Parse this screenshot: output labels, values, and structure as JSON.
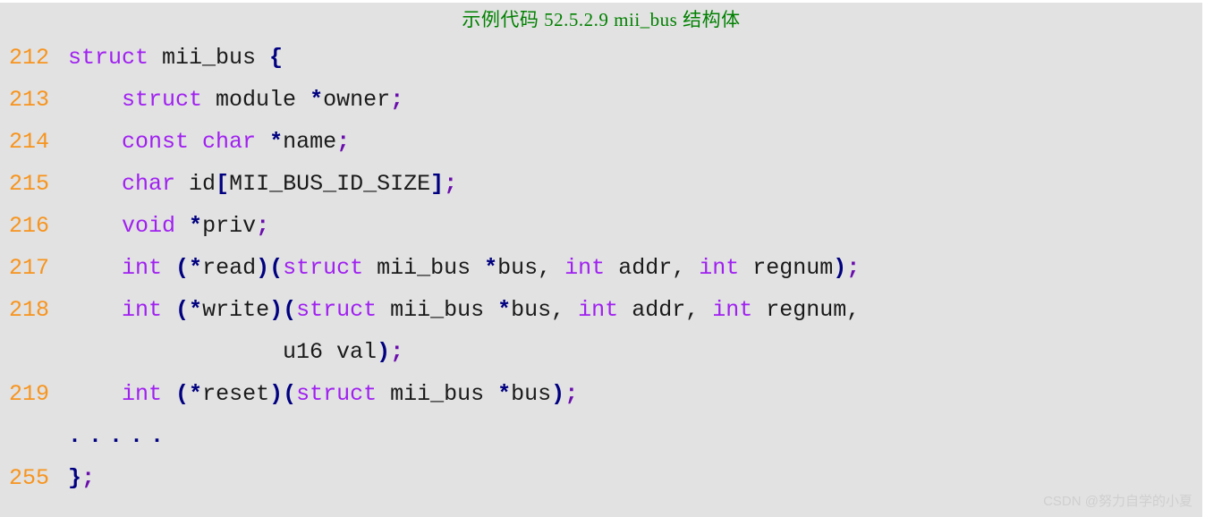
{
  "panel": {
    "background_color": "#e2e2e2",
    "title": "示例代码 52.5.2.9 mii_bus 结构体",
    "title_color": "#008000"
  },
  "colors": {
    "line_number": "#f7941e",
    "keyword": "#a020f0",
    "identifier": "#1a1a1a",
    "punctuation": "#000080",
    "semicolon": "#6a0dad",
    "watermark": "#cfcfcf"
  },
  "code": {
    "language": "c",
    "lines": [
      {
        "number": "212",
        "text": "struct mii_bus {",
        "tokens": [
          {
            "t": "kw",
            "v": "struct"
          },
          {
            "t": "id",
            "v": " mii_bus "
          },
          {
            "t": "punc",
            "v": "{"
          }
        ]
      },
      {
        "number": "213",
        "text": "    struct module *owner;",
        "tokens": [
          {
            "t": "id",
            "v": "    "
          },
          {
            "t": "kw",
            "v": "struct"
          },
          {
            "t": "id",
            "v": " module "
          },
          {
            "t": "punc",
            "v": "*"
          },
          {
            "t": "id",
            "v": "owner"
          },
          {
            "t": "semi",
            "v": ";"
          }
        ]
      },
      {
        "number": "214",
        "text": "    const char *name;",
        "tokens": [
          {
            "t": "id",
            "v": "    "
          },
          {
            "t": "kw",
            "v": "const char"
          },
          {
            "t": "id",
            "v": " "
          },
          {
            "t": "punc",
            "v": "*"
          },
          {
            "t": "id",
            "v": "name"
          },
          {
            "t": "semi",
            "v": ";"
          }
        ]
      },
      {
        "number": "215",
        "text": "    char id[MII_BUS_ID_SIZE];",
        "tokens": [
          {
            "t": "id",
            "v": "    "
          },
          {
            "t": "kw",
            "v": "char"
          },
          {
            "t": "id",
            "v": " id"
          },
          {
            "t": "punc",
            "v": "["
          },
          {
            "t": "id",
            "v": "MII_BUS_ID_SIZE"
          },
          {
            "t": "punc",
            "v": "]"
          },
          {
            "t": "semi",
            "v": ";"
          }
        ]
      },
      {
        "number": "216",
        "text": "    void *priv;",
        "tokens": [
          {
            "t": "id",
            "v": "    "
          },
          {
            "t": "kw",
            "v": "void"
          },
          {
            "t": "id",
            "v": " "
          },
          {
            "t": "punc",
            "v": "*"
          },
          {
            "t": "id",
            "v": "priv"
          },
          {
            "t": "semi",
            "v": ";"
          }
        ]
      },
      {
        "number": "217",
        "text": "    int (*read)(struct mii_bus *bus, int addr, int regnum);",
        "tokens": [
          {
            "t": "id",
            "v": "    "
          },
          {
            "t": "kw",
            "v": "int"
          },
          {
            "t": "id",
            "v": " "
          },
          {
            "t": "punc",
            "v": "(*"
          },
          {
            "t": "id",
            "v": "read"
          },
          {
            "t": "punc",
            "v": ")("
          },
          {
            "t": "kw",
            "v": "struct"
          },
          {
            "t": "id",
            "v": " mii_bus "
          },
          {
            "t": "punc",
            "v": "*"
          },
          {
            "t": "id",
            "v": "bus, "
          },
          {
            "t": "kw",
            "v": "int"
          },
          {
            "t": "id",
            "v": " addr, "
          },
          {
            "t": "kw",
            "v": "int"
          },
          {
            "t": "id",
            "v": " regnum"
          },
          {
            "t": "punc",
            "v": ")"
          },
          {
            "t": "semi",
            "v": ";"
          }
        ]
      },
      {
        "number": "218",
        "text": "    int (*write)(struct mii_bus *bus, int addr, int regnum,",
        "tokens": [
          {
            "t": "id",
            "v": "    "
          },
          {
            "t": "kw",
            "v": "int"
          },
          {
            "t": "id",
            "v": " "
          },
          {
            "t": "punc",
            "v": "(*"
          },
          {
            "t": "id",
            "v": "write"
          },
          {
            "t": "punc",
            "v": ")("
          },
          {
            "t": "kw",
            "v": "struct"
          },
          {
            "t": "id",
            "v": " mii_bus "
          },
          {
            "t": "punc",
            "v": "*"
          },
          {
            "t": "id",
            "v": "bus, "
          },
          {
            "t": "kw",
            "v": "int"
          },
          {
            "t": "id",
            "v": " addr, "
          },
          {
            "t": "kw",
            "v": "int"
          },
          {
            "t": "id",
            "v": " regnum,"
          }
        ]
      },
      {
        "number": "",
        "text": "                u16 val);",
        "tokens": [
          {
            "t": "id",
            "v": "                u16 val"
          },
          {
            "t": "punc",
            "v": ")"
          },
          {
            "t": "semi",
            "v": ";"
          }
        ]
      },
      {
        "number": "219",
        "text": "    int (*reset)(struct mii_bus *bus);",
        "tokens": [
          {
            "t": "id",
            "v": "    "
          },
          {
            "t": "kw",
            "v": "int"
          },
          {
            "t": "id",
            "v": " "
          },
          {
            "t": "punc",
            "v": "(*"
          },
          {
            "t": "id",
            "v": "reset"
          },
          {
            "t": "punc",
            "v": ")("
          },
          {
            "t": "kw",
            "v": "struct"
          },
          {
            "t": "id",
            "v": " mii_bus "
          },
          {
            "t": "punc",
            "v": "*"
          },
          {
            "t": "id",
            "v": "bus"
          },
          {
            "t": "punc",
            "v": ")"
          },
          {
            "t": "semi",
            "v": ";"
          }
        ]
      },
      {
        "number": "",
        "text": ".....",
        "tokens": [
          {
            "t": "dots",
            "v": "....."
          }
        ]
      },
      {
        "number": "255",
        "text": "};",
        "tokens": [
          {
            "t": "punc",
            "v": "}"
          },
          {
            "t": "semi",
            "v": ";"
          }
        ]
      }
    ]
  },
  "watermark": {
    "text": "CSDN @努力自学的小夏"
  }
}
